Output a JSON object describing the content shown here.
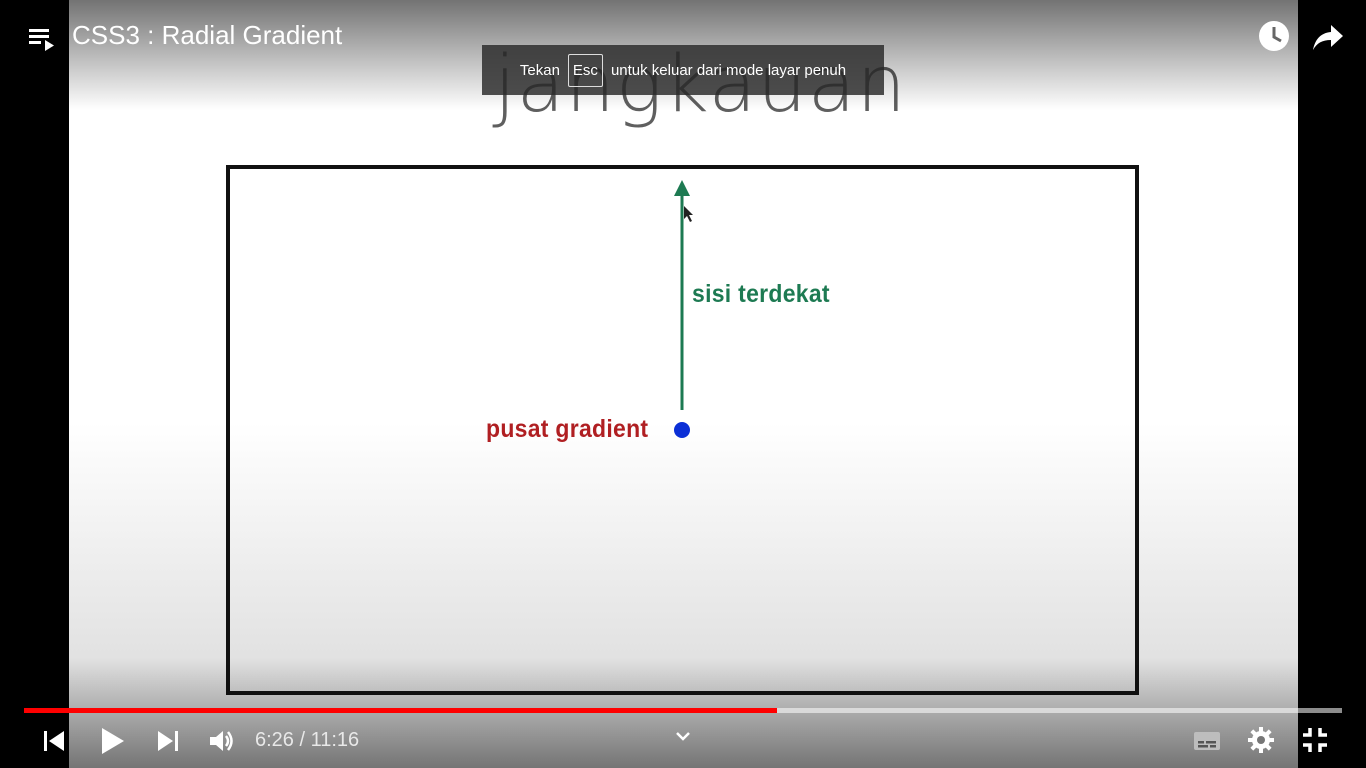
{
  "video": {
    "title": "CSS3 : Radial Gradient",
    "slide_heading": "jangkauan",
    "label_nearest_side": "sisi terdekat",
    "label_gradient_center": "pusat gradient",
    "colors": {
      "arrow": "#1d7a52",
      "center_dot": "#0b2fd6",
      "center_label": "#b01f22"
    }
  },
  "overlay": {
    "toast_before": "Tekan",
    "toast_key": "Esc",
    "toast_after": "untuk keluar dari mode layar penuh"
  },
  "icons": {
    "playlist": "playlist-icon",
    "watch_later": "clock-icon",
    "share": "share-arrow-icon",
    "prev": "skip-previous-icon",
    "play": "play-icon",
    "next": "skip-next-icon",
    "volume": "volume-icon",
    "more": "chevron-down-icon",
    "captions": "captions-icon",
    "settings": "gear-icon",
    "exit_fullscreen": "exit-fullscreen-icon"
  },
  "player": {
    "current_time": "6:26",
    "duration": "11:16",
    "time_text": "6:26 / 11:16",
    "progress_fraction": 0.571,
    "accent": "#ff0000"
  }
}
